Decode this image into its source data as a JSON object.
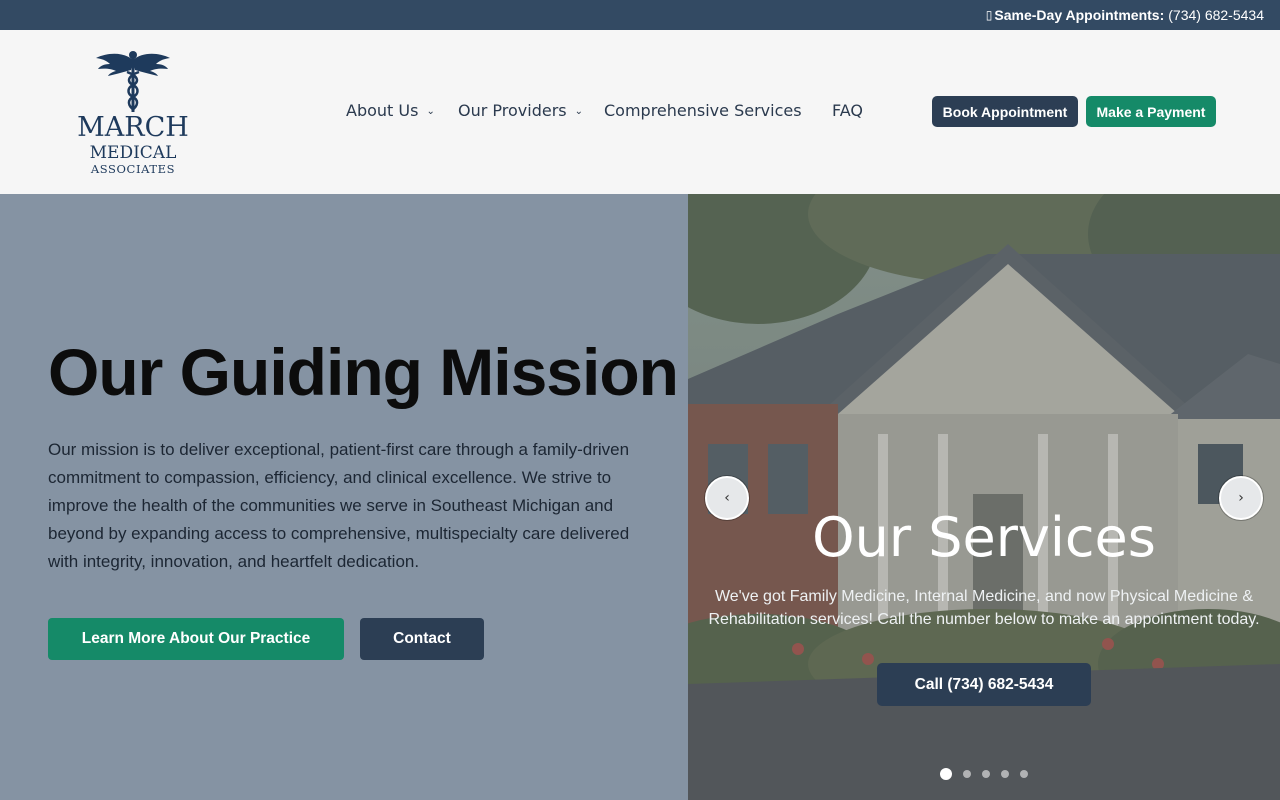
{
  "topbar": {
    "phone_glyph": "▯",
    "label": "Same-Day Appointments:",
    "phone": "(734) 682-5434"
  },
  "logo": {
    "line1": "MARCH",
    "line2": "MEDICAL",
    "line3": "ASSOCIATES",
    "icon": "caduceus-icon",
    "color": "#1e3a5c"
  },
  "nav": {
    "items": [
      {
        "label": "About Us",
        "has_dropdown": true
      },
      {
        "label": "Our Providers",
        "has_dropdown": true
      },
      {
        "label": "Comprehensive Services",
        "has_dropdown": false
      },
      {
        "label": "FAQ",
        "has_dropdown": false
      }
    ],
    "chevron": "⌄"
  },
  "header_buttons": {
    "book": "Book Appointment",
    "pay": "Make a Payment"
  },
  "hero": {
    "title": "Our Guiding Mission",
    "text": "Our mission is to deliver exceptional, patient-first care through a family-driven commitment to compassion, efficiency, and clinical excellence. We strive to improve the health of the communities we serve in Southeast Michigan and beyond by expanding access to comprehensive, multispecialty care delivered with integrity, innovation, and heartfelt dedication.",
    "learn_button": "Learn More About Our Practice",
    "contact_button": "Contact"
  },
  "slider": {
    "title": "Our Services",
    "text": "We've got Family Medicine, Internal Medicine, and now Physical Medicine & Rehabilitation services! Call the number below to make an appointment today.",
    "call_button": "Call (734) 682-5434",
    "prev_glyph": "‹",
    "next_glyph": "›",
    "slide_count": 5,
    "active_slide": 1
  },
  "colors": {
    "topbar": "#334a63",
    "navy": "#2c3e54",
    "green": "#158a68",
    "hero_bg": "#8593a3"
  }
}
